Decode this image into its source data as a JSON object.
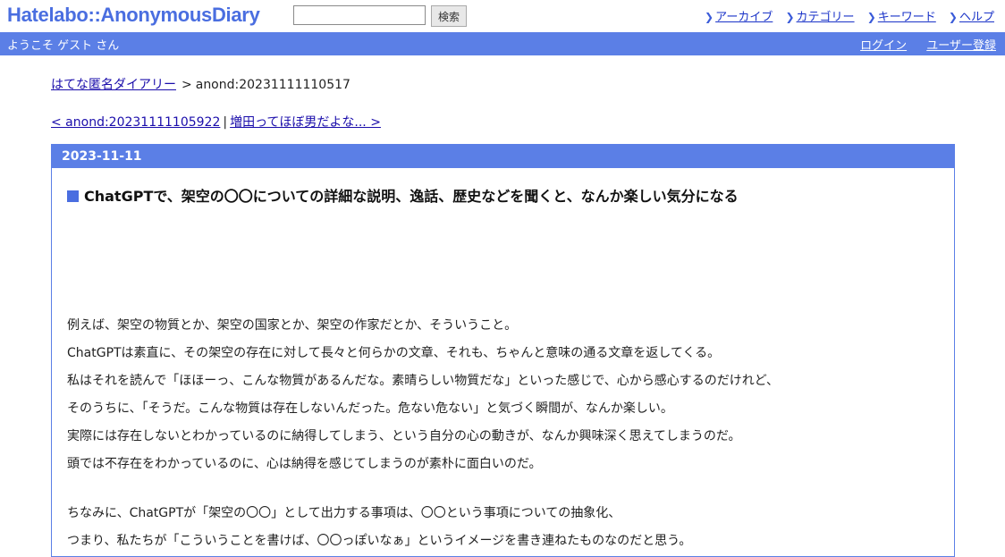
{
  "header": {
    "logo": "Hatelabo::AnonymousDiary",
    "search_placeholder": "",
    "search_button": "検索",
    "nav": [
      "アーカイブ",
      "カテゴリー",
      "キーワード",
      "ヘルプ"
    ]
  },
  "userbar": {
    "welcome": "ようこそ ゲスト さん",
    "login": "ログイン",
    "register": "ユーザー登録"
  },
  "breadcrumb": {
    "home": "はてな匿名ダイアリー",
    "separator": ">",
    "current": "anond:20231111110517"
  },
  "pagenav": {
    "prev": "< anond:20231111105922",
    "divider": "|",
    "next": "増田ってほぼ男だよな... >"
  },
  "entry": {
    "date": "2023-11-11",
    "title": "ChatGPTで、架空の〇〇についての詳細な説明、逸話、歴史などを聞くと、なんか楽しい気分になる",
    "paragraph1": [
      "例えば、架空の物質とか、架空の国家とか、架空の作家だとか、そういうこと。",
      "ChatGPTは素直に、その架空の存在に対して長々と何らかの文章、それも、ちゃんと意味の通る文章を返してくる。",
      "私はそれを読んで「ほほーっ、こんな物質があるんだな。素晴らしい物質だな」といった感じで、心から感心するのだけれど、",
      "そのうちに、「そうだ。こんな物質は存在しないんだった。危ない危ない」と気づく瞬間が、なんか楽しい。",
      "実際には存在しないとわかっているのに納得してしまう、という自分の心の動きが、なんか興味深く思えてしまうのだ。",
      "頭では不存在をわかっているのに、心は納得を感じてしまうのが素朴に面白いのだ。"
    ],
    "paragraph2": [
      "ちなみに、ChatGPTが「架空の〇〇」として出力する事項は、〇〇という事項についての抽象化、",
      "つまり、私たちが「こういうことを書けば、〇〇っぽいなぁ」というイメージを書き連ねたものなのだと思う。"
    ]
  },
  "colors": {
    "brand_blue": "#5b7fe6",
    "link": "#1a0dab"
  }
}
